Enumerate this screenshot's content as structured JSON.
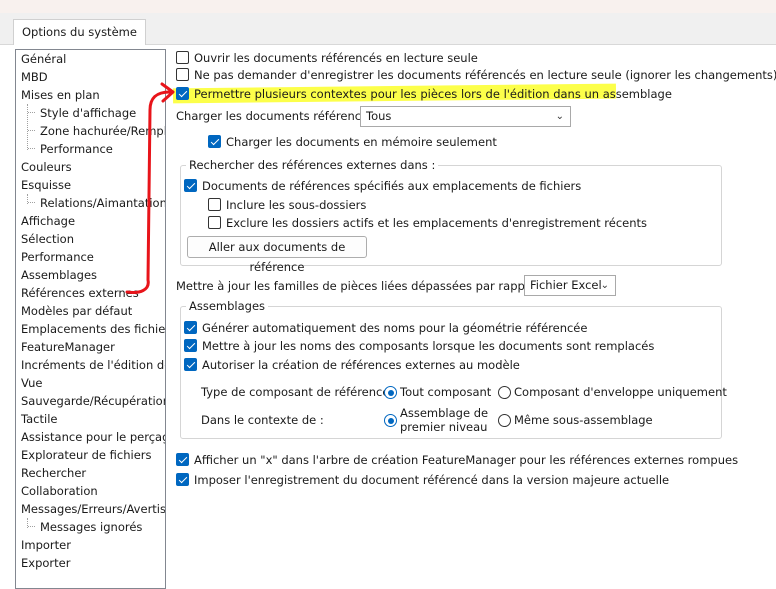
{
  "window": {
    "tab_label": "Options du système"
  },
  "tree": {
    "items": [
      {
        "label": "Général"
      },
      {
        "label": "MBD"
      },
      {
        "label": "Mises en plan"
      },
      {
        "label": "Style d'affichage"
      },
      {
        "label": "Zone hachurée/Remplir"
      },
      {
        "label": "Performance"
      },
      {
        "label": "Couleurs"
      },
      {
        "label": "Esquisse"
      },
      {
        "label": "Relations/Aimantation"
      },
      {
        "label": "Affichage"
      },
      {
        "label": "Sélection"
      },
      {
        "label": "Performance"
      },
      {
        "label": "Assemblages"
      },
      {
        "label": "Références externes"
      },
      {
        "label": "Modèles par défaut"
      },
      {
        "label": "Emplacements des fichiers"
      },
      {
        "label": "FeatureManager"
      },
      {
        "label": "Incréments de l'édition de c"
      },
      {
        "label": "Vue"
      },
      {
        "label": "Sauvegarde/Récupération"
      },
      {
        "label": "Tactile"
      },
      {
        "label": "Assistance pour le perçage/"
      },
      {
        "label": "Explorateur de fichiers"
      },
      {
        "label": "Rechercher"
      },
      {
        "label": "Collaboration"
      },
      {
        "label": "Messages/Erreurs/Avertisse"
      },
      {
        "label": "Messages ignorés"
      },
      {
        "label": "Importer"
      },
      {
        "label": "Exporter"
      }
    ]
  },
  "options": {
    "open_readonly": {
      "label": "Ouvrir les documents référencés en lecture seule",
      "checked": false
    },
    "no_save_prompt": {
      "label": "Ne pas demander d'enregistrer les documents référencés en lecture seule (ignorer les changements)",
      "checked": false
    },
    "multi_context": {
      "label": "Permettre plusieurs contextes pour les pièces lors de l'édition dans un assemblage",
      "checked": true
    },
    "load_docs_label": "Charger les documents référencés:",
    "load_docs_value": "Tous",
    "load_memory_only": {
      "label": "Charger les documents en mémoire seulement",
      "checked": true
    },
    "search_group": {
      "title": "Rechercher des références externes dans :",
      "specified_locations": {
        "label": "Documents de références spécifiés aux emplacements de fichiers",
        "checked": true
      },
      "include_subfolders": {
        "label": "Inclure les sous-dossiers",
        "checked": false
      },
      "exclude_active": {
        "label": "Exclure les dossiers actifs et les emplacements d'enregistrement récents",
        "checked": false
      },
      "goto_button": "Aller aux documents de référence"
    },
    "update_families_label": "Mettre à jour les familles de pièces liées dépassées par rapport au:",
    "update_families_value": "Fichier Excel",
    "assemblies_group": {
      "title": "Assemblages",
      "auto_names": {
        "label": "Générer automatiquement des noms pour la géométrie référencée",
        "checked": true
      },
      "update_names": {
        "label": "Mettre à jour les noms des composants lorsque les documents sont remplacés",
        "checked": true
      },
      "allow_ext_refs": {
        "label": "Autoriser la création de références externes au modèle",
        "checked": true
      },
      "ref_type_label": "Type de composant de référence :",
      "ref_type_any": "Tout composant",
      "ref_type_envelope": "Composant d'enveloppe uniquement",
      "ref_type_selected": "Tout composant",
      "context_label": "Dans le contexte de :",
      "context_top_line1": "Assemblage de",
      "context_top_line2": "premier niveau",
      "context_same": "Même sous-assemblage",
      "context_selected": "Assemblage de premier niveau"
    },
    "show_x": {
      "label": "Afficher un \"x\" dans l'arbre de création FeatureManager pour les références externes rompues",
      "checked": true
    },
    "force_save": {
      "label": "Imposer l'enregistrement du document référencé dans la version majeure actuelle",
      "checked": true
    }
  },
  "colors": {
    "accent": "#0067c0",
    "annotation_red": "#e8141a",
    "highlight_yellow": "#fbff2a"
  }
}
